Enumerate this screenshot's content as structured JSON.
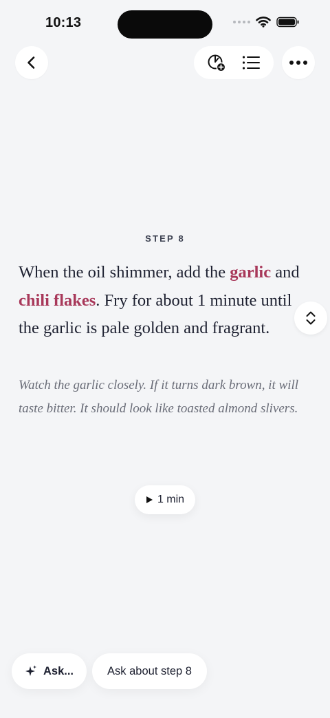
{
  "status_bar": {
    "time": "10:13"
  },
  "nav": {
    "back_icon": "chevron-left-icon",
    "timer_add_icon": "timer-add-icon",
    "list_icon": "list-icon",
    "more_icon": "more-horizontal-icon"
  },
  "step": {
    "label": "STEP 8",
    "text_parts": {
      "p1": "When the oil shimmer, add the ",
      "ingredient1": "garlic",
      "p2": " and ",
      "ingredient2": "chili flakes",
      "p3": ". Fry for about 1 minute until the garlic is pale golden and fragrant."
    },
    "tip": "Watch the garlic closely. If it turns dark brown, it will taste bitter. It should look like toasted almond slivers."
  },
  "timer": {
    "label": "1 min"
  },
  "ask": {
    "general_label": "Ask...",
    "step_label": "Ask about step 8"
  },
  "colors": {
    "background": "#f4f5f7",
    "ingredient_accent": "#a8385a",
    "text_primary": "#1d2030"
  }
}
